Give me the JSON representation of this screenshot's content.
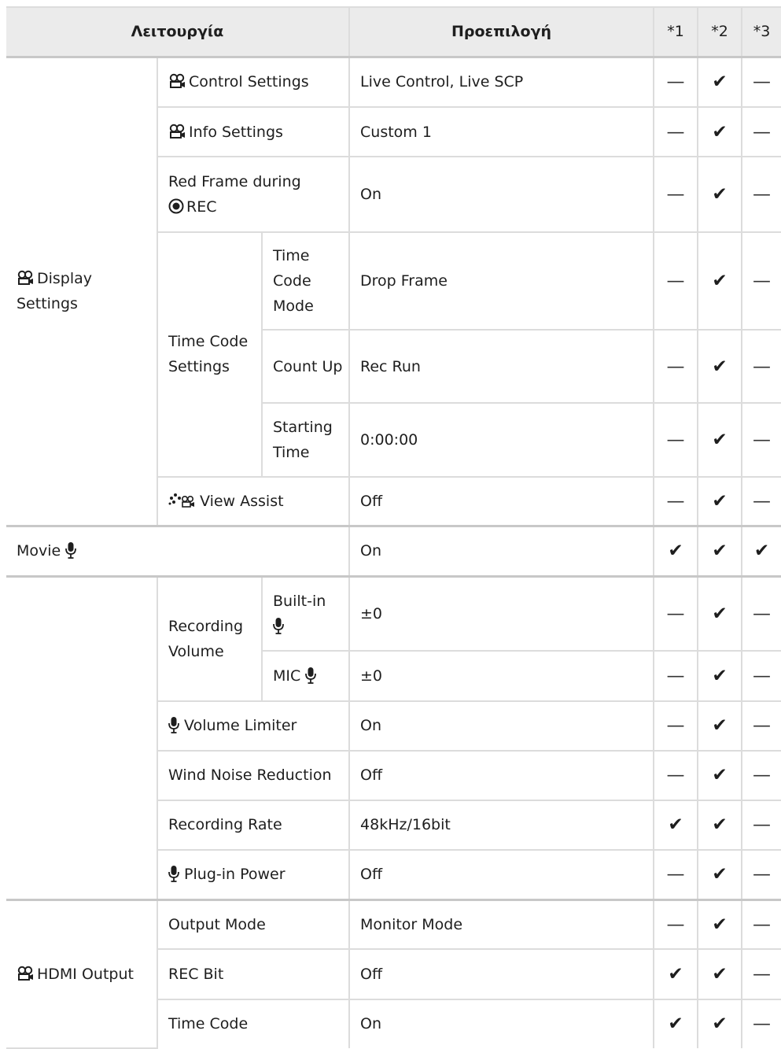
{
  "header": {
    "function": "Λειτουργία",
    "default": "Προεπιλογή",
    "c1": "*1",
    "c2": "*2",
    "c3": "*3"
  },
  "marks": {
    "check": "✔",
    "dash": "—"
  },
  "groups": {
    "display_settings": "Display Settings",
    "time_code_settings": "Time Code Settings",
    "movie_mic": "Movie",
    "recording_volume": "Recording Volume",
    "hdmi_output": "HDMI Output"
  },
  "rows": [
    {
      "label": "Control Settings",
      "value": "Live Control, Live SCP",
      "m": [
        "—",
        "✔",
        "—"
      ]
    },
    {
      "label": "Info Settings",
      "value": "Custom 1",
      "m": [
        "—",
        "✔",
        "—"
      ]
    },
    {
      "label": "Red Frame during",
      "label2": "REC",
      "value": "On",
      "m": [
        "—",
        "✔",
        "—"
      ]
    },
    {
      "label": "Time Code Mode",
      "value": "Drop Frame",
      "m": [
        "—",
        "✔",
        "—"
      ]
    },
    {
      "label": "Count Up",
      "value": "Rec Run",
      "m": [
        "—",
        "✔",
        "—"
      ]
    },
    {
      "label": "Starting Time",
      "value": "0:00:00",
      "m": [
        "—",
        "✔",
        "—"
      ]
    },
    {
      "label": "View Assist",
      "value": "Off",
      "m": [
        "—",
        "✔",
        "—"
      ]
    },
    {
      "label": "",
      "value": "On",
      "m": [
        "✔",
        "✔",
        "✔"
      ]
    },
    {
      "label": "Built-in",
      "value": "±0",
      "m": [
        "—",
        "✔",
        "—"
      ]
    },
    {
      "label": "MIC",
      "value": "±0",
      "m": [
        "—",
        "✔",
        "—"
      ]
    },
    {
      "label": "Volume Limiter",
      "value": "On",
      "m": [
        "—",
        "✔",
        "—"
      ]
    },
    {
      "label": "Wind Noise Reduction",
      "value": "Off",
      "m": [
        "—",
        "✔",
        "—"
      ]
    },
    {
      "label": "Recording Rate",
      "value": "48kHz/16bit",
      "m": [
        "✔",
        "✔",
        "—"
      ]
    },
    {
      "label": "Plug-in Power",
      "value": "Off",
      "m": [
        "—",
        "✔",
        "—"
      ]
    },
    {
      "label": "Output Mode",
      "value": "Monitor Mode",
      "m": [
        "—",
        "✔",
        "—"
      ]
    },
    {
      "label": "REC Bit",
      "value": "Off",
      "m": [
        "✔",
        "✔",
        "—"
      ]
    },
    {
      "label": "Time Code",
      "value": "On",
      "m": [
        "✔",
        "✔",
        "—"
      ]
    }
  ],
  "icons": {
    "movie": "movie-camera-icon",
    "mic": "microphone-icon",
    "rec": "record-icon",
    "view_assist": "view-assist-icon"
  }
}
